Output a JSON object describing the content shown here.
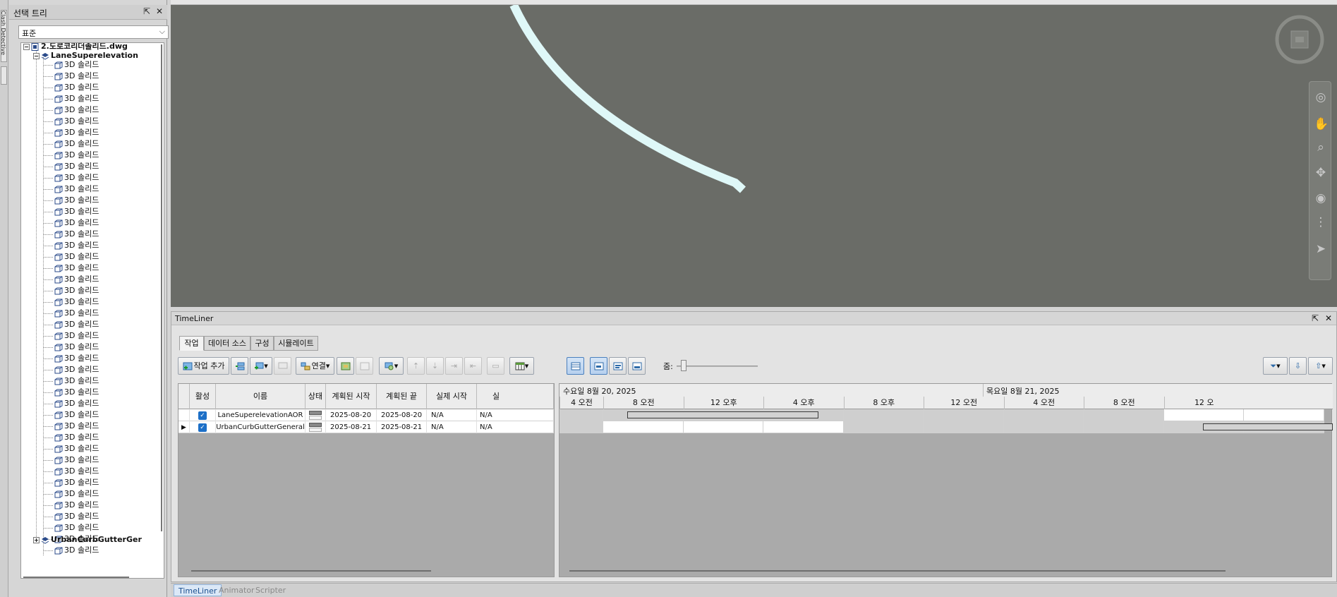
{
  "left_strip": {
    "tab1_label": "Clash Detective",
    "tab2_label": ""
  },
  "tree_panel": {
    "title": "선택 트리",
    "dropdown_value": "표준",
    "root_file": "2.도로코리더솔리드.dwg",
    "group1": "LaneSuperelevation",
    "group2": "UrbanCurbGutterGer",
    "leaf_label": "3D 솔리드",
    "leaf_count": 44
  },
  "timeliner": {
    "title": "TimeLiner",
    "tabs": [
      "작업",
      "데이터 소스",
      "구성",
      "시뮬레이트"
    ],
    "toolbar": {
      "add_task": "작업 추가",
      "link": "연결",
      "zoom_label": "줌:",
      "zoom_level": 0.05
    },
    "grid": {
      "columns": [
        "활성",
        "이름",
        "상태",
        "계획된 시작",
        "계획된 끝",
        "실제 시작",
        "실"
      ],
      "rows": [
        {
          "active": true,
          "name": "LaneSuperelevationAOR",
          "planned_start": "2025-08-20",
          "planned_end": "2025-08-20",
          "actual_start": "N/A",
          "actual_end": "N/A",
          "current": false
        },
        {
          "active": true,
          "name": "UrbanCurbGutterGeneral",
          "planned_start": "2025-08-21",
          "planned_end": "2025-08-21",
          "actual_start": "N/A",
          "actual_end": "N/A",
          "current": true
        }
      ]
    },
    "gantt": {
      "day1": "수요일 8월 20, 2025",
      "day2": "목요일 8월 21, 2025",
      "ticks": [
        "4 오전",
        "8 오전",
        "12 오후",
        "4 오후",
        "8 오후",
        "12 오전",
        "4 오전",
        "8 오전",
        "12 오"
      ]
    }
  },
  "bottom_tabs": [
    "TimeLiner",
    "Animator",
    "Scripter"
  ],
  "colors": {
    "viewport_bg": "#6a6c67",
    "road_stroke": "#dff8f8",
    "checkbox_blue": "#1c6fc7"
  }
}
